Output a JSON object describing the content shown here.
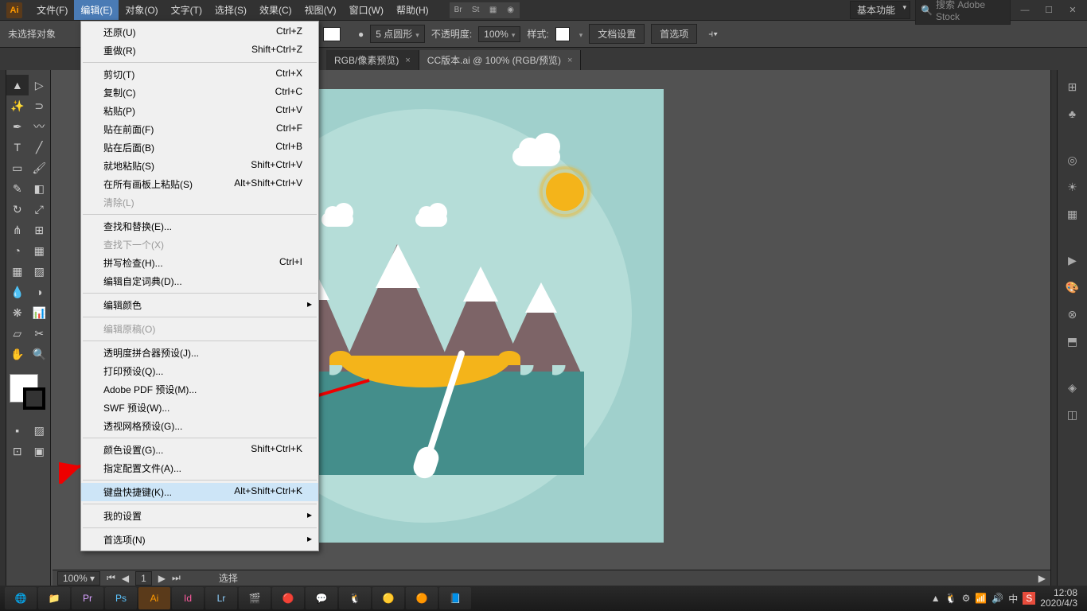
{
  "menubar": {
    "items": [
      "文件(F)",
      "编辑(E)",
      "对象(O)",
      "文字(T)",
      "选择(S)",
      "效果(C)",
      "视图(V)",
      "窗口(W)",
      "帮助(H)"
    ],
    "active_index": 1,
    "workspace": "基本功能",
    "search_placeholder": "搜索 Adobe Stock"
  },
  "controlbar": {
    "selection_label": "未选择对象",
    "stroke_style": "5 点圆形",
    "opacity_label": "不透明度:",
    "opacity_value": "100%",
    "style_label": "样式:",
    "doc_setup": "文档设置",
    "prefs": "首选项"
  },
  "tabs": [
    {
      "label": "RGB/像素预览)",
      "active": false
    },
    {
      "label": "CC版本.ai @ 100% (RGB/预览)",
      "active": true
    }
  ],
  "statusbar": {
    "zoom": "100%",
    "artboard_nav": "1",
    "tool_label": "选择"
  },
  "dropdown": {
    "items": [
      {
        "label": "还原(U)",
        "shortcut": "Ctrl+Z"
      },
      {
        "label": "重做(R)",
        "shortcut": "Shift+Ctrl+Z"
      },
      {
        "sep": true
      },
      {
        "label": "剪切(T)",
        "shortcut": "Ctrl+X"
      },
      {
        "label": "复制(C)",
        "shortcut": "Ctrl+C"
      },
      {
        "label": "粘贴(P)",
        "shortcut": "Ctrl+V"
      },
      {
        "label": "贴在前面(F)",
        "shortcut": "Ctrl+F"
      },
      {
        "label": "贴在后面(B)",
        "shortcut": "Ctrl+B"
      },
      {
        "label": "就地粘贴(S)",
        "shortcut": "Shift+Ctrl+V"
      },
      {
        "label": "在所有画板上粘贴(S)",
        "shortcut": "Alt+Shift+Ctrl+V"
      },
      {
        "label": "清除(L)",
        "disabled": true
      },
      {
        "sep": true
      },
      {
        "label": "查找和替换(E)..."
      },
      {
        "label": "查找下一个(X)",
        "disabled": true
      },
      {
        "label": "拼写检查(H)...",
        "shortcut": "Ctrl+I"
      },
      {
        "label": "编辑自定词典(D)..."
      },
      {
        "sep": true
      },
      {
        "label": "编辑颜色",
        "submenu": true
      },
      {
        "sep": true
      },
      {
        "label": "编辑原稿(O)",
        "disabled": true
      },
      {
        "sep": true
      },
      {
        "label": "透明度拼合器预设(J)..."
      },
      {
        "label": "打印预设(Q)..."
      },
      {
        "label": "Adobe PDF 预设(M)..."
      },
      {
        "label": "SWF 预设(W)..."
      },
      {
        "label": "透视网格预设(G)..."
      },
      {
        "sep": true
      },
      {
        "label": "颜色设置(G)...",
        "shortcut": "Shift+Ctrl+K"
      },
      {
        "label": "指定配置文件(A)..."
      },
      {
        "sep": true
      },
      {
        "label": "键盘快捷键(K)...",
        "shortcut": "Alt+Shift+Ctrl+K",
        "hover": true
      },
      {
        "sep": true
      },
      {
        "label": "我的设置",
        "submenu": true
      },
      {
        "sep": true
      },
      {
        "label": "首选项(N)",
        "submenu": true
      }
    ]
  },
  "taskbar": {
    "time": "12:08",
    "date": "2020/4/3"
  }
}
